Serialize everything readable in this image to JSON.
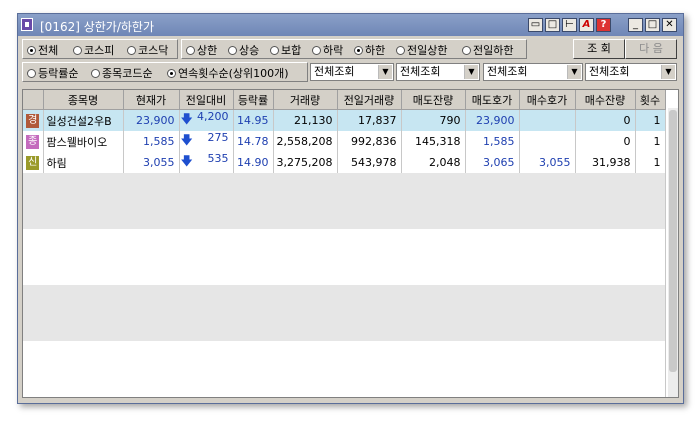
{
  "window": {
    "title": "[0162] 상한가/하한가"
  },
  "titlebar_buttons": [
    "layout-icon",
    "window-icon",
    "pin-icon",
    "font-icon",
    "help-icon",
    "minimize-icon",
    "maximize-icon",
    "close-icon"
  ],
  "titlebar_glyphs": {
    "font": "A",
    "help": "?",
    "minimize": "_",
    "maximize": "□",
    "close": "✕"
  },
  "market_filter": {
    "options": [
      "전체",
      "코스피",
      "코스닥"
    ],
    "selected": "전체"
  },
  "type_filter": {
    "options": [
      "상한",
      "상승",
      "보합",
      "하락",
      "하한",
      "전일상한",
      "전일하한"
    ],
    "selected": "하한"
  },
  "sort_filter": {
    "options": [
      "등락률순",
      "종목코드순",
      "연속횟수순(상위100개)"
    ],
    "selected": "연속횟수순(상위100개)"
  },
  "dropdowns": [
    "전체조회",
    "전체조회",
    "전체조회",
    "전체조회"
  ],
  "buttons": {
    "query": "조 회",
    "next": "다 음"
  },
  "table": {
    "columns": [
      "종목명",
      "현재가",
      "전일대비",
      "등락률",
      "거래량",
      "전일거래량",
      "매도잔량",
      "매도호가",
      "매수호가",
      "매수잔량",
      "횟수"
    ],
    "rows": [
      {
        "badge": "경",
        "badge_color": "#b05a3a",
        "name": "일성건설2우B",
        "price": "23,900",
        "change": "4,200",
        "rate": "14.95",
        "volume": "21,130",
        "prev_volume": "17,837",
        "ask_qty": "790",
        "ask_price": "23,900",
        "bid_price": "",
        "bid_qty": "0",
        "count": "1"
      },
      {
        "badge": "종",
        "badge_color": "#c46bbd",
        "name": "팜스웰바이오",
        "price": "1,585",
        "change": "275",
        "rate": "14.78",
        "volume": "2,558,208",
        "prev_volume": "992,836",
        "ask_qty": "145,318",
        "ask_price": "1,585",
        "bid_price": "",
        "bid_qty": "0",
        "count": "1"
      },
      {
        "badge": "신",
        "badge_color": "#9a9a2a",
        "name": "하림",
        "price": "3,055",
        "change": "535",
        "rate": "14.90",
        "volume": "3,275,208",
        "prev_volume": "543,978",
        "ask_qty": "2,048",
        "ask_price": "3,065",
        "bid_price": "3,055",
        "bid_qty": "31,938",
        "count": "1"
      }
    ]
  },
  "colors": {
    "title_bar": "#7a90bf",
    "selected_row": "#c7e6f2",
    "blue_text": "#1e3fb0",
    "down_arrow": "#1e4fcf"
  }
}
